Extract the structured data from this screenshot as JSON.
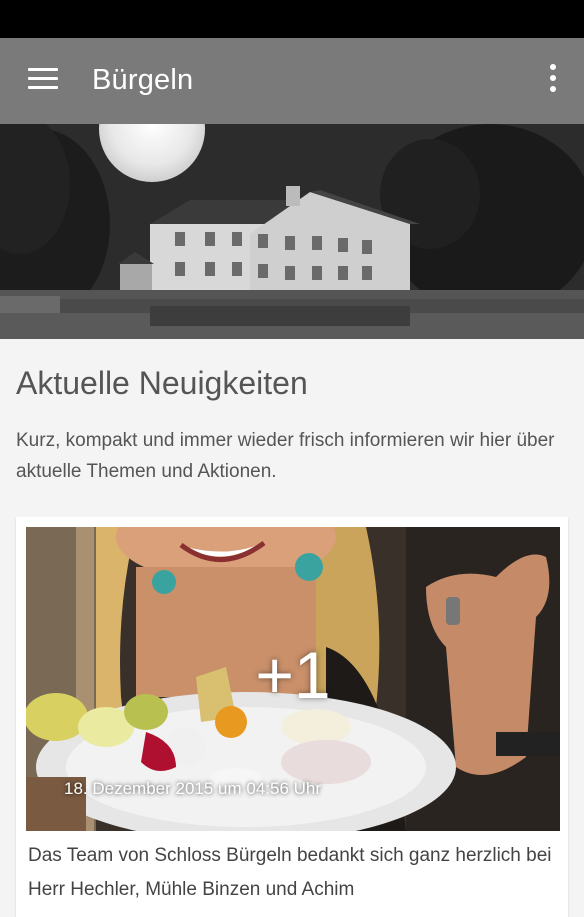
{
  "app_bar": {
    "title": "Bürgeln",
    "menu_icon": "hamburger-menu-icon",
    "overflow_icon": "more-vert-icon",
    "color": "#7a7a7a"
  },
  "main": {
    "section_title": "Aktuelle Neuigkeiten",
    "section_description": "Kurz, kompakt und immer wieder frisch informieren wir hier über aktuelle Themen und Aktionen."
  },
  "news_card": {
    "plus_count": "+1",
    "date": "18. Dezember 2015 um 04:56 Uhr",
    "text": "Das Team von Schloss Bürgeln bedankt sich ganz herzlich bei Herr Hechler, Mühle Binzen und Achim"
  }
}
